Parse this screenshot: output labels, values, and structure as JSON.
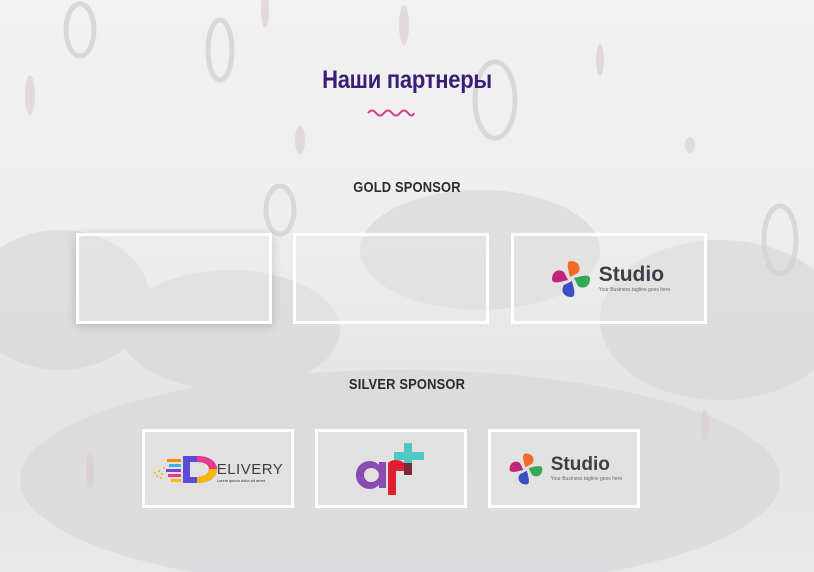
{
  "section": {
    "title": "Наши партнеры",
    "accent_color": "#d63d8a",
    "title_color": "#3a1d74"
  },
  "tiers": [
    {
      "label": "GOLD SPONSOR",
      "sponsors": [
        {
          "logo": "empty"
        },
        {
          "logo": "empty"
        },
        {
          "logo": "studio",
          "name": "Studio",
          "tagline": "Your Business tagline goes here"
        }
      ]
    },
    {
      "label": "SILVER SPONSOR",
      "sponsors": [
        {
          "logo": "delivery",
          "name": "ELIVERY",
          "tagline": "Lorem ipsum dolor sit amet"
        },
        {
          "logo": "art"
        },
        {
          "logo": "studio",
          "name": "Studio",
          "tagline": "Your Business tagline goes here"
        }
      ]
    }
  ]
}
